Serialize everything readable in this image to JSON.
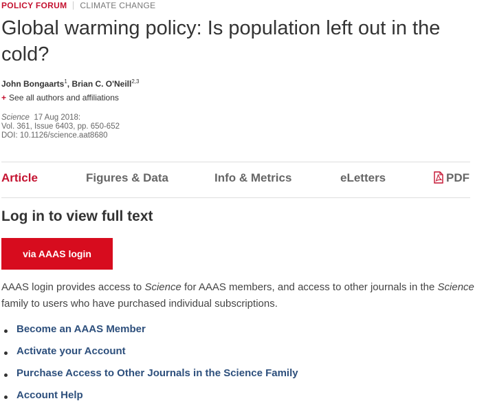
{
  "header": {
    "section": "POLICY FORUM",
    "subsection": "CLIMATE CHANGE",
    "title": "Global warming policy: Is population left out in the cold?"
  },
  "authors": [
    {
      "name": "John Bongaarts",
      "affil": "1"
    },
    {
      "name": "Brian C. O'Neill",
      "affil": "2,3"
    }
  ],
  "see_all": "See all authors and affiliations",
  "citation": {
    "journal": "Science",
    "date": "17 Aug 2018:",
    "volume": "Vol. 361, Issue 6403, pp. 650-652",
    "doi": "DOI: 10.1126/science.aat8680"
  },
  "tabs": [
    {
      "label": "Article",
      "active": true
    },
    {
      "label": "Figures & Data",
      "active": false
    },
    {
      "label": "Info & Metrics",
      "active": false
    },
    {
      "label": "eLetters",
      "active": false
    },
    {
      "label": "PDF",
      "active": false,
      "icon": "pdf-icon"
    }
  ],
  "login": {
    "heading": "Log in to view full text",
    "button": "via AAAS login",
    "desc_1": "AAAS login provides access to ",
    "desc_journal_1": "Science",
    "desc_2": " for AAAS members, and access to other journals in the ",
    "desc_journal_2": "Science",
    "desc_3": " family to users who have purchased individual subscriptions."
  },
  "links": [
    "Become an AAAS Member",
    "Activate your Account",
    "Purchase Access to Other Journals in the Science Family",
    "Account Help"
  ],
  "colors": {
    "accent": "#c41230",
    "button": "#d70c1e",
    "link": "#2d4f7c"
  }
}
